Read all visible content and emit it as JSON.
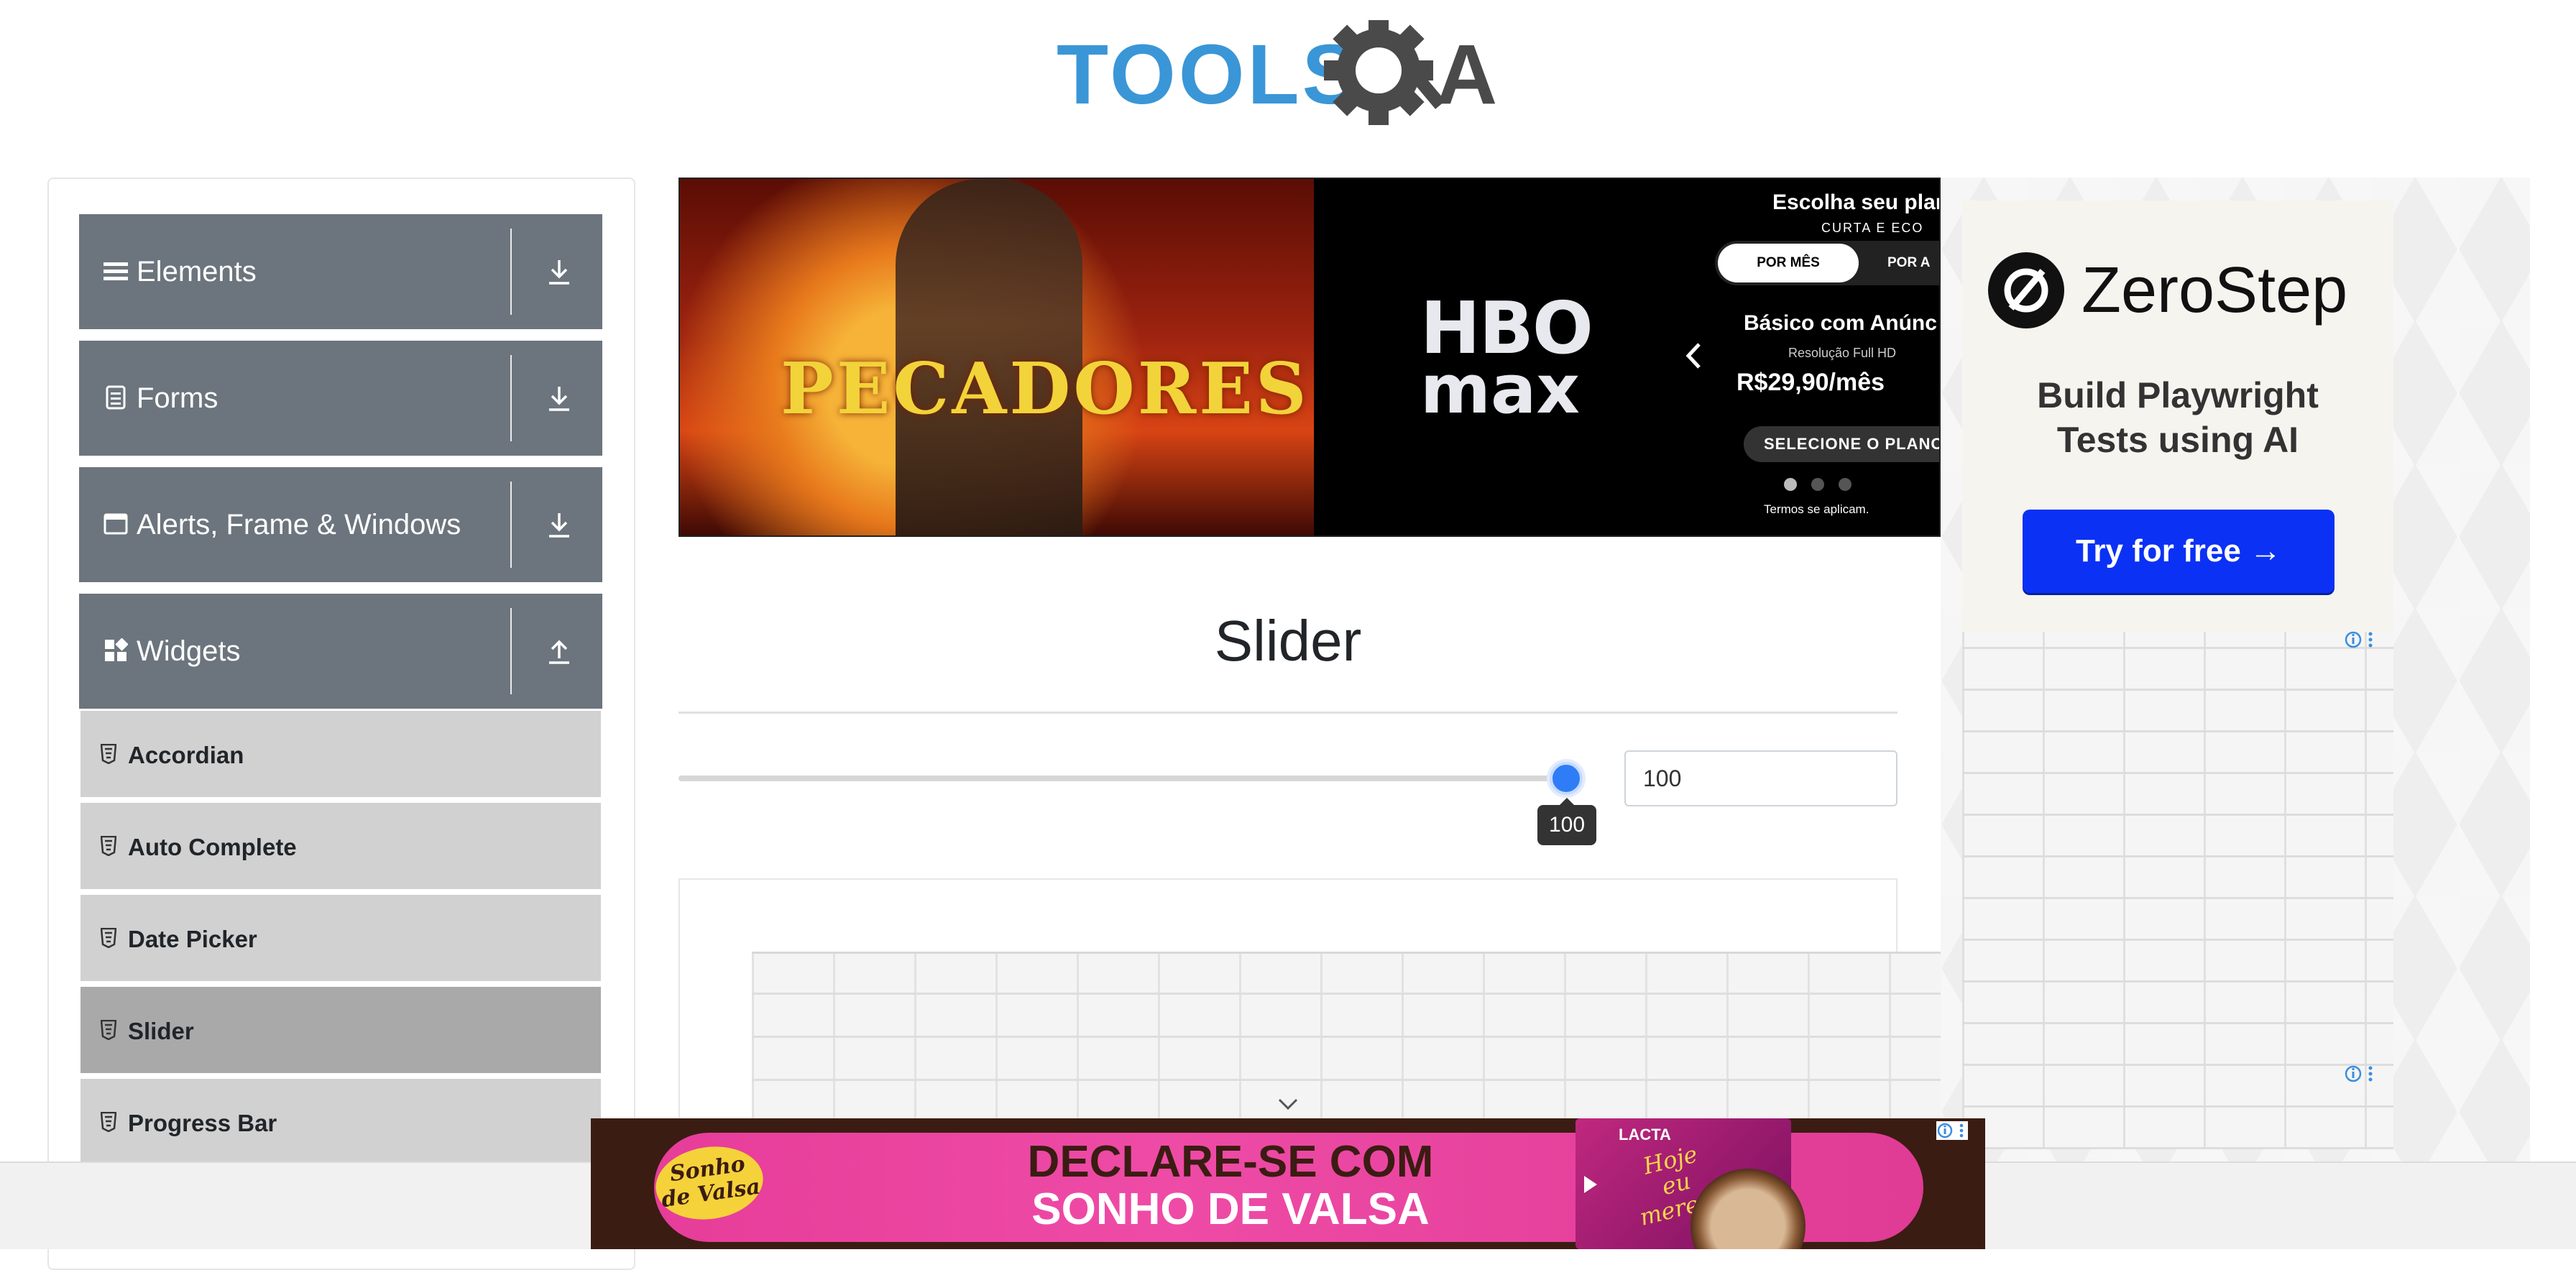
{
  "header": {
    "logo_text": "TOOLSQA"
  },
  "sidebar": {
    "groups": [
      {
        "label": "Elements",
        "icon": "list-icon",
        "arrow": "download-arrow-icon"
      },
      {
        "label": "Forms",
        "icon": "document-icon",
        "arrow": "download-arrow-icon"
      },
      {
        "label": "Alerts, Frame & Windows",
        "icon": "window-icon",
        "arrow": "download-arrow-icon"
      },
      {
        "label": "Widgets",
        "icon": "widgets-icon",
        "arrow": "upload-arrow-icon",
        "expanded": true
      }
    ],
    "items": [
      {
        "label": "Accordian",
        "icon": "html5-icon"
      },
      {
        "label": "Auto Complete",
        "icon": "html5-icon"
      },
      {
        "label": "Date Picker",
        "icon": "html5-icon"
      },
      {
        "label": "Slider",
        "icon": "html5-icon",
        "active": true
      },
      {
        "label": "Progress Bar",
        "icon": "html5-icon"
      }
    ]
  },
  "hbo_ad": {
    "movie_title": "PECADORES",
    "logo_line1": "HBO",
    "logo_line2": "max",
    "choose_plan": "Escolha seu plano",
    "choose_sub": "CURTA E ECO",
    "toggle_on": "POR MÊS",
    "toggle_off": "POR A",
    "plan_name": "Básico com Anúnc",
    "resolution": "Resolução Full HD",
    "price": "R$29,90/mês",
    "cta": "SELECIONE O PLANO",
    "terms": "Termos se aplicam."
  },
  "main": {
    "title": "Slider",
    "slider": {
      "value": 100,
      "min": 0,
      "max": 100,
      "tooltip": "100",
      "input_value": "100"
    }
  },
  "right_ad": {
    "brand": "ZeroStep",
    "tagline_line1": "Build Playwright",
    "tagline_line2": "Tests using AI",
    "button": "Try for free →"
  },
  "bottom_ad": {
    "brand": "Sonho de Valsa",
    "line1": "DECLARE-SE COM",
    "line2": "SONHO DE VALSA",
    "pack_brand": "LACTA",
    "pack_text": "Hoje eu mereço"
  },
  "colors": {
    "accent": "#2f7df6",
    "sidebar_header": "#6c757d",
    "sidebar_item": "#d1d1d1",
    "sidebar_active": "#a9a9a9",
    "cta_blue": "#0b31f5"
  }
}
